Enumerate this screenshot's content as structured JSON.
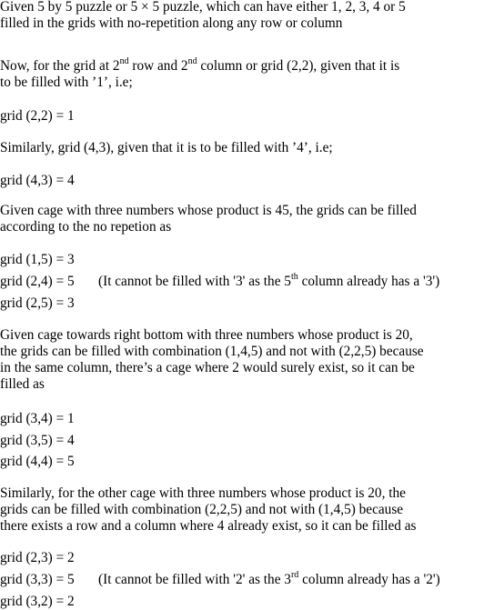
{
  "intro": {
    "lines": [
      "Given 5 by 5 puzzle or 5 × 5 puzzle, which can have either 1, 2, 3, 4 or 5",
      "filled in the grids with no-repetition along any row or column"
    ]
  },
  "p2": {
    "l1a": "Now, for the grid at 2",
    "sup1": "nd",
    "l1b": " row and 2",
    "sup2": "nd",
    "l1c": " column or grid (2,2), given that it is",
    "l2": "to be filled with ’1’, i.e;"
  },
  "eq1": "grid (2,2) = 1",
  "p3": "Similarly, grid (4,3), given that it is to be filled with ’4’, i.e;",
  "eq2": "grid (4,3) = 4",
  "p4": {
    "lines": [
      "Given cage with three numbers whose product is 45, the grids can be filled",
      "according to the no repetion as"
    ]
  },
  "block1": {
    "g15": "grid (1,5) = 3",
    "g24": "grid (2,4) = 5",
    "note_a": "(It cannot be filled with '3' as the 5",
    "note_sup": "th",
    "note_b": " column already has a '3')",
    "g25": "grid (2,5) = 3"
  },
  "p5": {
    "lines": [
      "Given cage towards right bottom with three numbers whose product is 20,",
      "the grids can be filled with combination (1,4,5) and not with (2,2,5) because",
      "in the same column, there’s a cage where 2 would surely exist, so it can be",
      "filled as"
    ]
  },
  "block2": {
    "g34": "grid (3,4) = 1",
    "g35": "grid (3,5) = 4",
    "g44": "grid (4,4) = 5"
  },
  "p6": {
    "lines": [
      "Similarly, for the other cage with three numbers whose product is 20, the",
      "grids can be filled with combination (2,2,5) and not with (1,4,5) because",
      "there exists a row and a column where 4 already exist, so it can be filled as"
    ]
  },
  "block3": {
    "g23": "grid (2,3) = 2",
    "g33": "grid (3,3) = 5",
    "note_a": "(It cannot be filled with '2' as the 3",
    "note_sup": "rd",
    "note_b": " column already has a '2')",
    "g32": "grid (3,2) = 2"
  }
}
